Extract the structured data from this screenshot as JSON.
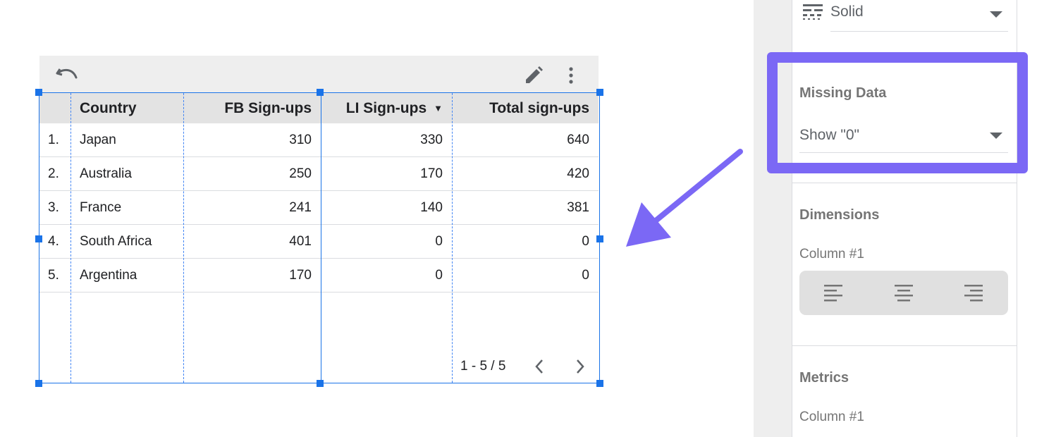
{
  "table": {
    "columns": [
      "",
      "Country",
      "FB Sign-ups",
      "LI Sign-ups",
      "Total sign-ups"
    ],
    "sort_indicator": "▼",
    "rows": [
      {
        "index": "1.",
        "country": "Japan",
        "fb": "310",
        "li": "330",
        "total": "640"
      },
      {
        "index": "2.",
        "country": "Australia",
        "fb": "250",
        "li": "170",
        "total": "420"
      },
      {
        "index": "3.",
        "country": "France",
        "fb": "241",
        "li": "140",
        "total": "381"
      },
      {
        "index": "4.",
        "country": "South Africa",
        "fb": "401",
        "li": "0",
        "total": "0"
      },
      {
        "index": "5.",
        "country": "Argentina",
        "fb": "170",
        "li": "0",
        "total": "0"
      }
    ],
    "pagination": "1 - 5 / 5"
  },
  "panel": {
    "line_style": {
      "value": "Solid",
      "icon": "line-style-icon"
    },
    "missing_data": {
      "title": "Missing Data",
      "value": "Show \"0\""
    },
    "dimensions": {
      "title": "Dimensions",
      "column_label": "Column #1"
    },
    "metrics": {
      "title": "Metrics",
      "column_label": "Column #1"
    }
  },
  "colors": {
    "accent": "#1a73e8",
    "highlight": "#7b68f5",
    "header_bg": "#e3e3e3",
    "toolbar_bg": "#eeeeee"
  },
  "icons": [
    "undo-icon",
    "pencil-icon",
    "more-vert-icon",
    "chevron-left-icon",
    "chevron-right-icon",
    "align-left-icon",
    "align-center-icon",
    "align-right-icon"
  ]
}
